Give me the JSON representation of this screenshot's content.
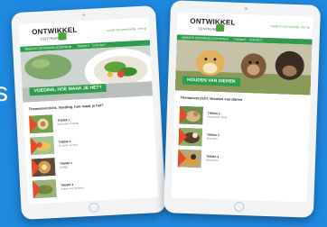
{
  "background_text": "s",
  "colors": {
    "background": "#1f88df",
    "brand_green": "#2e9c4d",
    "accent_orange": "#e64b2c"
  },
  "left_tablet": {
    "logo": "ONTWIKKEL",
    "logo_sub": "CENTRUM",
    "tagline": "maakt het persoonlijk, niet op",
    "nav": [
      "WEBSITE ONTWIKKELSCENTRUM",
      "THEMA'S",
      "CONTACT"
    ],
    "hero_title": "VOEDING, HOE MAAK JE HET?",
    "section_title": "Themaoverzicht: Voeding, hoe maak je het?",
    "themes": [
      {
        "title": "THEMA 1",
        "subtitle": "Gezonde voeding"
      },
      {
        "title": "THEMA 2",
        "subtitle": "Groente en fruit"
      },
      {
        "title": "THEMA 3",
        "subtitle": "Ontbijt"
      },
      {
        "title": "THEMA 4",
        "subtitle": "Koken met groente"
      }
    ]
  },
  "right_tablet": {
    "logo": "ONTWIKKEL",
    "logo_sub": "CENTRUM",
    "tagline": "maakt het persoonlijk, niet op",
    "nav": [
      "WEBSITE ONTWIKKELSCENTRUM",
      "THEMA'S",
      "CONTACT"
    ],
    "hero_title": "HOUDEN VAN DIEREN",
    "section_title": "Themaoverzicht: Houden van dieren",
    "themes": [
      {
        "title": "THEMA 1",
        "subtitle": "Huisdieren thuis"
      },
      {
        "title": "THEMA 2",
        "subtitle": "Boerderij"
      },
      {
        "title": "THEMA 3",
        "subtitle": "Dierentuin"
      }
    ]
  }
}
